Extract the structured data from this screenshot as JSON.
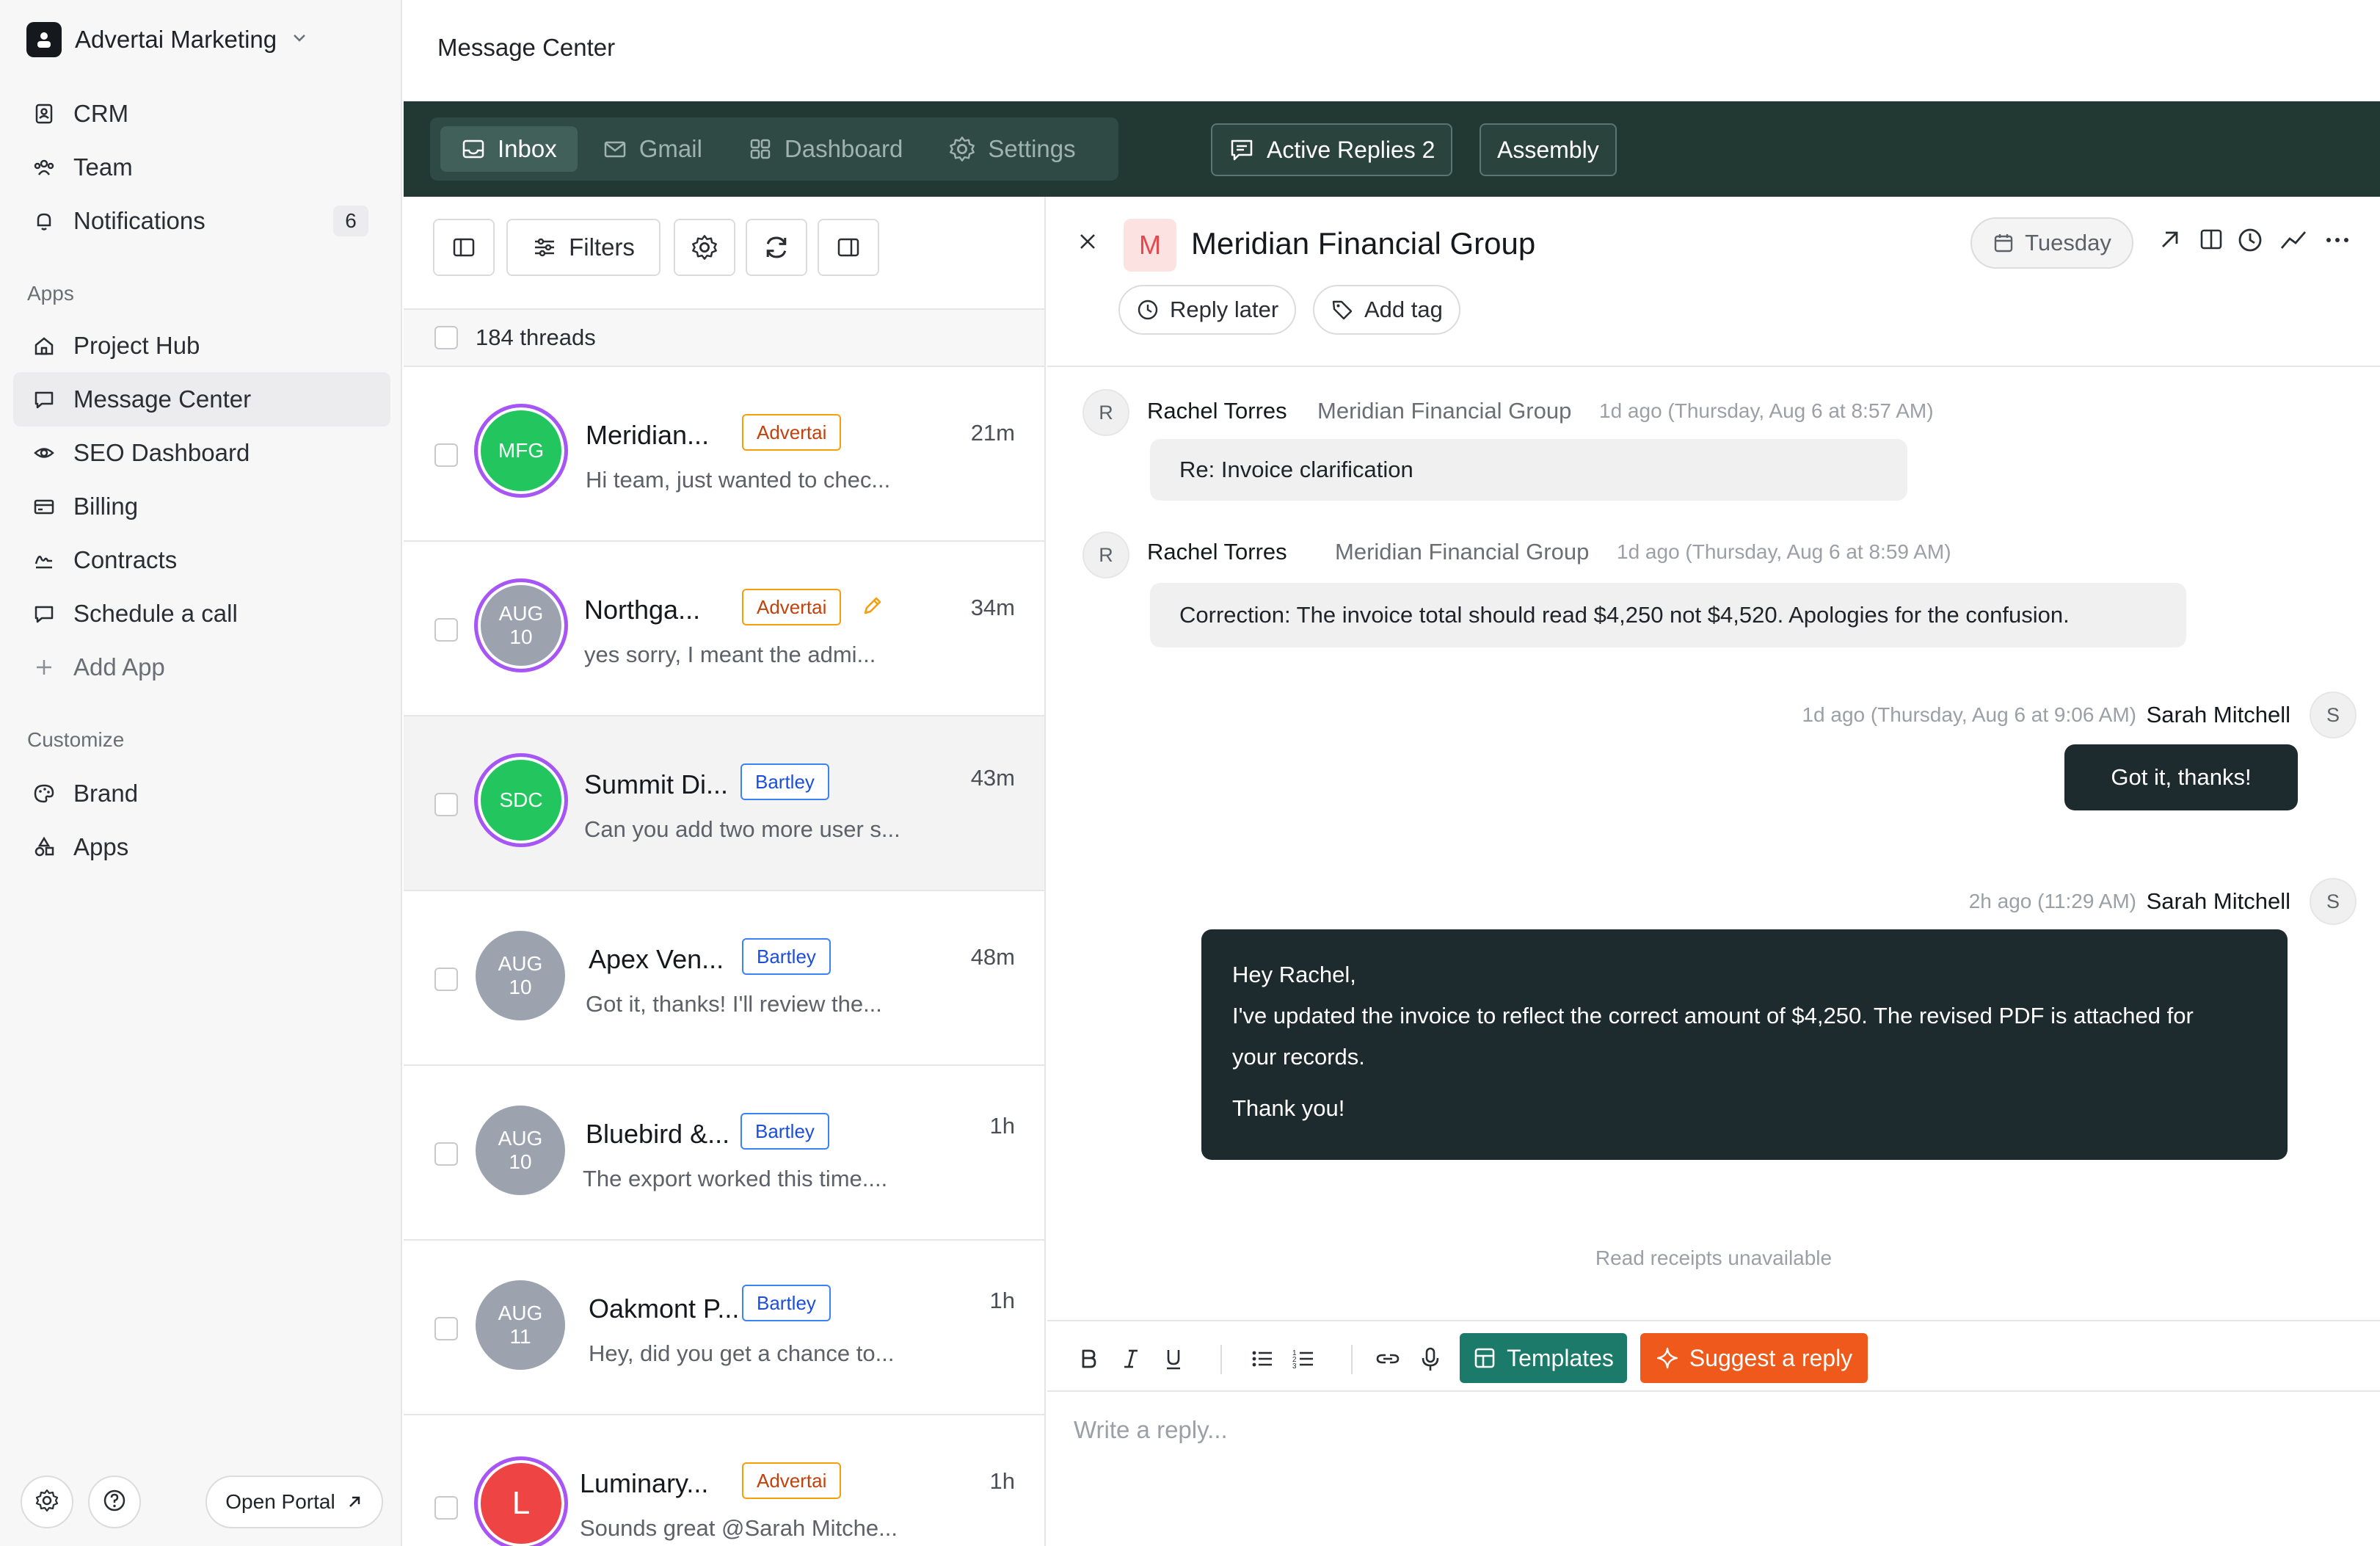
{
  "workspace": {
    "name": "Advertai Marketing"
  },
  "sidebar": {
    "items": [
      {
        "label": "CRM",
        "icon": "contact-book-icon"
      },
      {
        "label": "Team",
        "icon": "team-icon"
      },
      {
        "label": "Notifications",
        "icon": "bell-icon",
        "badge": "6"
      }
    ],
    "apps_label": "Apps",
    "apps": [
      {
        "label": "Project Hub",
        "icon": "home-icon"
      },
      {
        "label": "Message Center",
        "icon": "chat-bubble-icon",
        "active": true
      },
      {
        "label": "SEO Dashboard",
        "icon": "eye-icon"
      },
      {
        "label": "Billing",
        "icon": "card-icon"
      },
      {
        "label": "Contracts",
        "icon": "signature-icon"
      },
      {
        "label": "Schedule a call",
        "icon": "chat-bubble-icon"
      }
    ],
    "add_app_label": "Add App",
    "customize_label": "Customize",
    "customize": [
      {
        "label": "Brand",
        "icon": "palette-icon"
      },
      {
        "label": "Apps",
        "icon": "shapes-icon"
      }
    ],
    "open_portal_label": "Open Portal"
  },
  "header": {
    "title": "Message Center"
  },
  "tabs": [
    {
      "label": "Inbox",
      "icon": "inbox-icon",
      "active": true
    },
    {
      "label": "Gmail",
      "icon": "mail-icon"
    },
    {
      "label": "Dashboard",
      "icon": "grid-icon"
    },
    {
      "label": "Settings",
      "icon": "gear-icon"
    }
  ],
  "topbar": {
    "active_replies_label": "Active Replies 2",
    "assembly_label": "Assembly"
  },
  "list": {
    "filters_label": "Filters",
    "thread_count": "184 threads",
    "threads": [
      {
        "name": "Meridian...",
        "tag": "Advertai",
        "time": "21m",
        "snippet": "Hi team, just wanted to chec...",
        "avatar": "MFG",
        "avatar_line2": ""
      },
      {
        "name": "Northga...",
        "tag": "Advertai",
        "time": "34m",
        "snippet": "yes sorry, I meant the admi...",
        "avatar": "AUG",
        "avatar_line2": "10"
      },
      {
        "name": "Summit Di...",
        "tag": "Bartley",
        "time": "43m",
        "snippet": "Can you add two more user s...",
        "avatar": "SDC",
        "avatar_line2": ""
      },
      {
        "name": "Apex Ven...",
        "tag": "Bartley",
        "time": "48m",
        "snippet": "Got it, thanks! I'll review the...",
        "avatar": "AUG",
        "avatar_line2": "10"
      },
      {
        "name": "Bluebird &...",
        "tag": "Bartley",
        "time": "1h",
        "snippet": "The export worked this time....",
        "avatar": "AUG",
        "avatar_line2": "10"
      },
      {
        "name": "Oakmont P...",
        "tag": "Bartley",
        "time": "1h",
        "snippet": "Hey, did you get a chance to...",
        "avatar": "AUG",
        "avatar_line2": "11"
      },
      {
        "name": "Luminary...",
        "tag": "Advertai",
        "time": "1h",
        "snippet": "Sounds great @Sarah Mitche...",
        "avatar": "L",
        "avatar_line2": ""
      }
    ]
  },
  "conversation": {
    "avatar_letter": "M",
    "title": "Meridian Financial Group",
    "date_label": "Tuesday",
    "reply_later_label": "Reply later",
    "add_tag_label": "Add tag",
    "messages": [
      {
        "avatar": "R",
        "sender": "Rachel Torres",
        "org": "Meridian Financial Group",
        "time": "1d ago (Thursday, Aug 6 at 8:57 AM)",
        "body": "Re: Invoice clarification"
      },
      {
        "avatar": "R",
        "sender": "Rachel Torres",
        "org": "Meridian Financial Group",
        "time": "1d ago (Thursday, Aug 6 at 8:59 AM)",
        "body": "Correction: The invoice total should read $4,250 not $4,520. Apologies for the confusion."
      },
      {
        "avatar": "S",
        "sender": "Sarah Mitchell",
        "time": "1d ago (Thursday, Aug 6 at 9:06 AM)",
        "body": "Got it, thanks!"
      },
      {
        "avatar": "S",
        "sender": "Sarah Mitchell",
        "time": "2h ago (11:29 AM)",
        "body_lines": [
          "Hey Rachel,",
          "I've updated the invoice to reflect the correct amount of $4,250. The revised PDF is attached for",
          "your records.",
          "Thank you!"
        ]
      }
    ],
    "read_receipts": "Read receipts unavailable"
  },
  "composer": {
    "templates_label": "Templates",
    "suggest_label": "Suggest a reply",
    "placeholder": "Write a reply..."
  },
  "colors": {
    "tabbar_bg": "#223833",
    "templates_btn": "#1c7a6a",
    "suggest_btn": "#ef5a1c",
    "outgoing_bubble": "#1d2a2e",
    "tag_advertai": "#f59e0b",
    "tag_bartley": "#3b82f6",
    "avatar_ring": "#a855f7"
  }
}
